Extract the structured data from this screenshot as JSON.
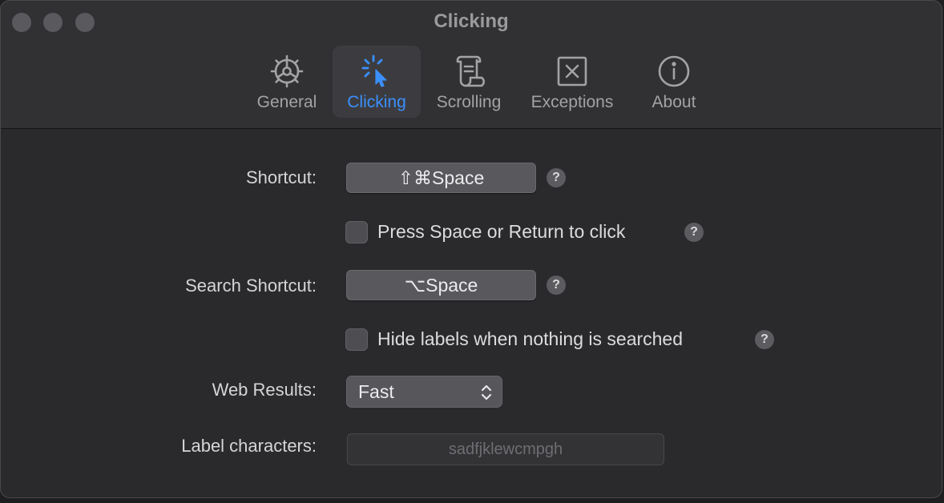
{
  "window": {
    "title": "Clicking"
  },
  "toolbar": {
    "tabs": [
      {
        "label": "General",
        "icon": "gear-icon"
      },
      {
        "label": "Clicking",
        "icon": "cursor-click-icon"
      },
      {
        "label": "Scrolling",
        "icon": "scroll-icon"
      },
      {
        "label": "Exceptions",
        "icon": "x-square-icon"
      },
      {
        "label": "About",
        "icon": "info-icon"
      }
    ],
    "selected_tab": "Clicking"
  },
  "settings": {
    "shortcut": {
      "label": "Shortcut:",
      "value": "⇧⌘Space",
      "help": "?"
    },
    "press_space": {
      "label": "Press Space or Return to click",
      "checked": false,
      "help": "?"
    },
    "search_shortcut": {
      "label": "Search Shortcut:",
      "value": "⌥Space",
      "help": "?"
    },
    "hide_labels": {
      "label": "Hide labels when nothing is searched",
      "checked": false,
      "help": "?"
    },
    "web_results": {
      "label": "Web Results:",
      "value": "Fast"
    },
    "label_characters": {
      "label": "Label characters:",
      "placeholder": "sadfjklewcmpgh"
    }
  },
  "colors": {
    "accent": "#3b8ffb",
    "window_bg": "#2a2a2d",
    "toolbar_bg": "#313134"
  }
}
